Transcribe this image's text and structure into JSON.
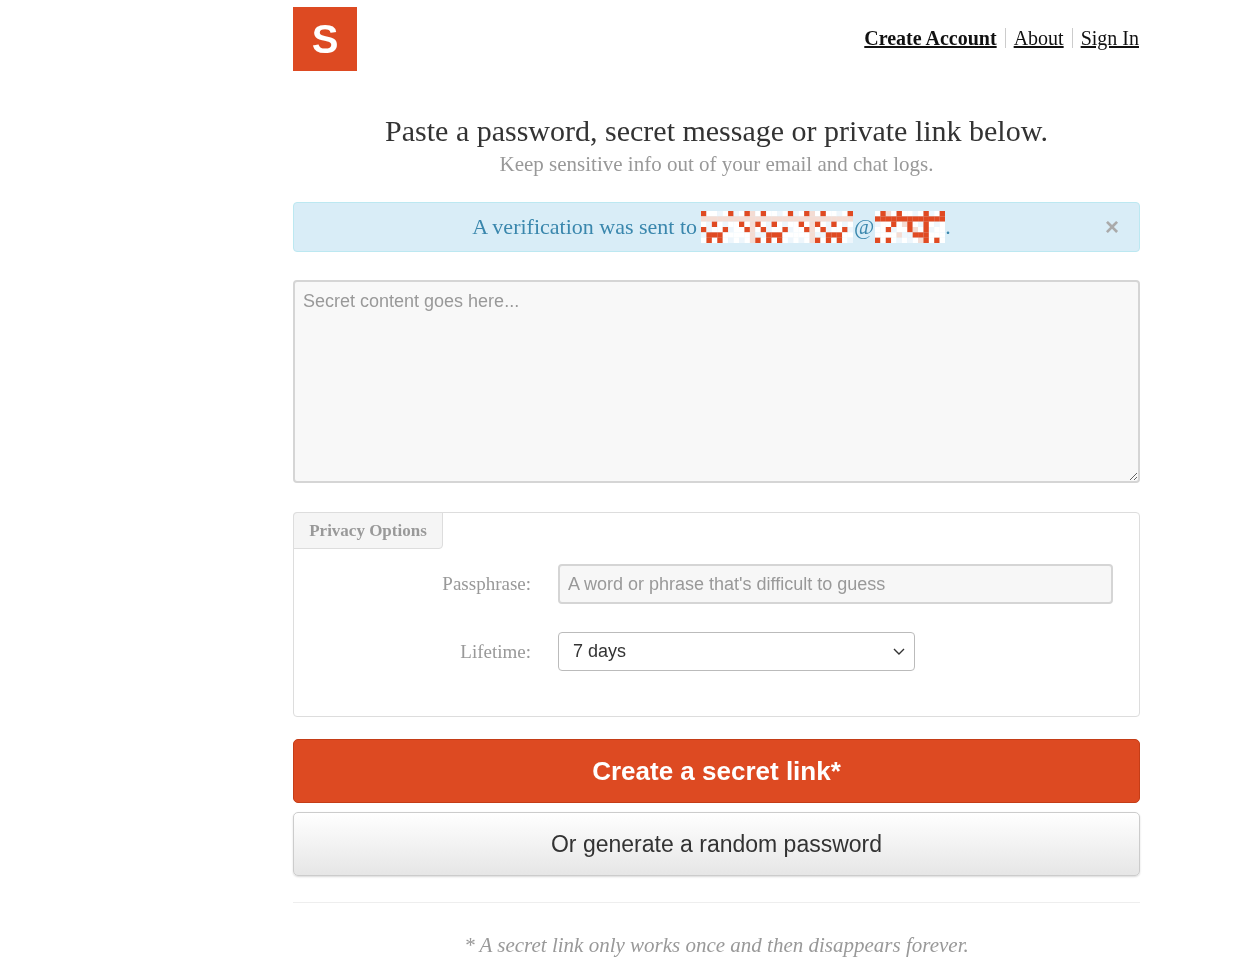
{
  "header": {
    "logo": "S",
    "nav": [
      {
        "label": "Create Account",
        "selected": true
      },
      {
        "label": "About",
        "selected": false
      },
      {
        "label": "Sign In",
        "selected": false
      }
    ]
  },
  "intro": {
    "title": "Paste a password, secret message or private link below.",
    "subtitle": "Keep sensitive info out of your email and chat logs."
  },
  "alert": {
    "text": "A verification was sent to",
    "at": "@",
    "end": ".",
    "close": "×"
  },
  "secret": {
    "placeholder": "Secret content goes here..."
  },
  "privacy": {
    "title": "Privacy Options",
    "fields": [
      {
        "kind": "text",
        "label": "Passphrase:",
        "placeholder": "A word or phrase that's difficult to guess"
      },
      {
        "kind": "select",
        "label": "Lifetime:",
        "value": "7 days"
      }
    ]
  },
  "buttons": [
    {
      "kind": "primary",
      "label": "Create a secret link*"
    },
    {
      "kind": "secondary",
      "label": "Or generate a random password"
    }
  ],
  "footer": {
    "note": "* A secret link only works once and then disappears forever."
  }
}
